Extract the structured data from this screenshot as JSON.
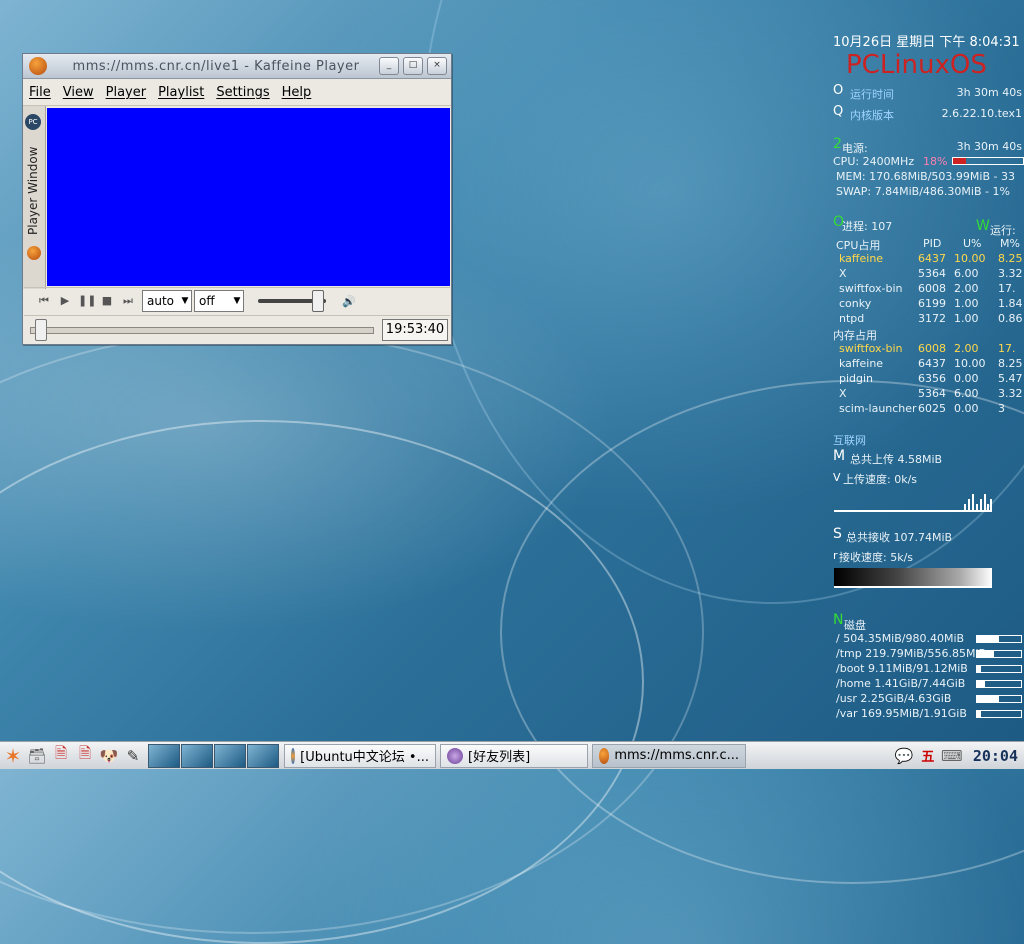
{
  "player": {
    "title": "mms://mms.cnr.cn/live1 - Kaffeine Player",
    "menu": [
      "File",
      "View",
      "Player",
      "Playlist",
      "Settings",
      "Help"
    ],
    "side_tab": "Player Window",
    "pc_logo": "PC",
    "video_color": "#0000ff",
    "aspect_combo": "auto",
    "subtitle_combo": "off",
    "volume_fraction": 0.9,
    "seek_fraction": 0.0,
    "time": "19:53:40",
    "buttons": {
      "minimize": "_",
      "maximize": "□",
      "close": "×"
    }
  },
  "conky": {
    "datetime": "10月26日 星期日  下午 8:04:31",
    "logo": "PCLinuxOS",
    "uptime_label": "运行时间",
    "uptime_value": "3h 30m 40s",
    "kernel_label": "内核版本",
    "kernel_value": "2.6.22.10.tex1",
    "power_label": "电源:",
    "power_value": "3h 30m 40s",
    "cpu_line": "CPU: 2400MHz",
    "cpu_percent_text": "18%",
    "cpu_fraction": 0.18,
    "mem_line": "MEM: 170.68MiB/503.99MiB - 33",
    "swap_line": "SWAP: 7.84MiB/486.30MiB - 1%",
    "procs_label": "进程:  107",
    "running_label": "运行:",
    "cpu_table": {
      "title": "CPU占用",
      "headers": [
        "PID",
        "U%",
        "M%"
      ],
      "rows": [
        [
          "kaffeine",
          "6437",
          "10.00",
          "8.25"
        ],
        [
          "X",
          "5364",
          "6.00",
          "3.32"
        ],
        [
          "swiftfox-bin",
          "6008",
          "2.00",
          "17."
        ],
        [
          "conky",
          "6199",
          "1.00",
          "1.84"
        ],
        [
          "ntpd",
          "3172",
          "1.00",
          "0.86"
        ]
      ]
    },
    "mem_table": {
      "title": "内存占用",
      "rows": [
        [
          "swiftfox-bin",
          "6008",
          "2.00",
          "17."
        ],
        [
          "kaffeine",
          "6437",
          "10.00",
          "8.25"
        ],
        [
          "pidgin",
          "6356",
          "0.00",
          "5.47"
        ],
        [
          "X",
          "5364",
          "6.00",
          "3.32"
        ],
        [
          "scim-launcher",
          "6025",
          "0.00",
          "3"
        ]
      ]
    },
    "net_title": "互联网",
    "upload_total": "总共上传 4.58MiB",
    "upload_speed": "上传速度: 0k/s",
    "download_total": "总共接收 107.74MiB",
    "download_speed": "接收速度: 5k/s",
    "disk_title": "磁盘",
    "disks": [
      {
        "label": "/ 504.35MiB/980.40MiB",
        "fraction": 0.51
      },
      {
        "label": "/tmp 219.79MiB/556.85MiB",
        "fraction": 0.39
      },
      {
        "label": "/boot 9.11MiB/91.12MiB",
        "fraction": 0.1
      },
      {
        "label": "/home 1.41GiB/7.44GiB",
        "fraction": 0.19
      },
      {
        "label": "/usr 2.25GiB/4.63GiB",
        "fraction": 0.49
      },
      {
        "label": "/var 169.95MiB/1.91GiB",
        "fraction": 0.09
      }
    ],
    "glyphs": {
      "uptime": "O",
      "kernel": "Q",
      "power": "2",
      "procs": "O",
      "running": "W",
      "up": "M",
      "upv": "V",
      "down": "S",
      "downr": "r",
      "disk": "N"
    }
  },
  "taskbar": {
    "tasks": [
      "[Ubuntu中文论坛 •...",
      "[好友列表]",
      "mms://mms.cnr.c..."
    ],
    "tray_ime": "五",
    "clock": "20:04"
  }
}
